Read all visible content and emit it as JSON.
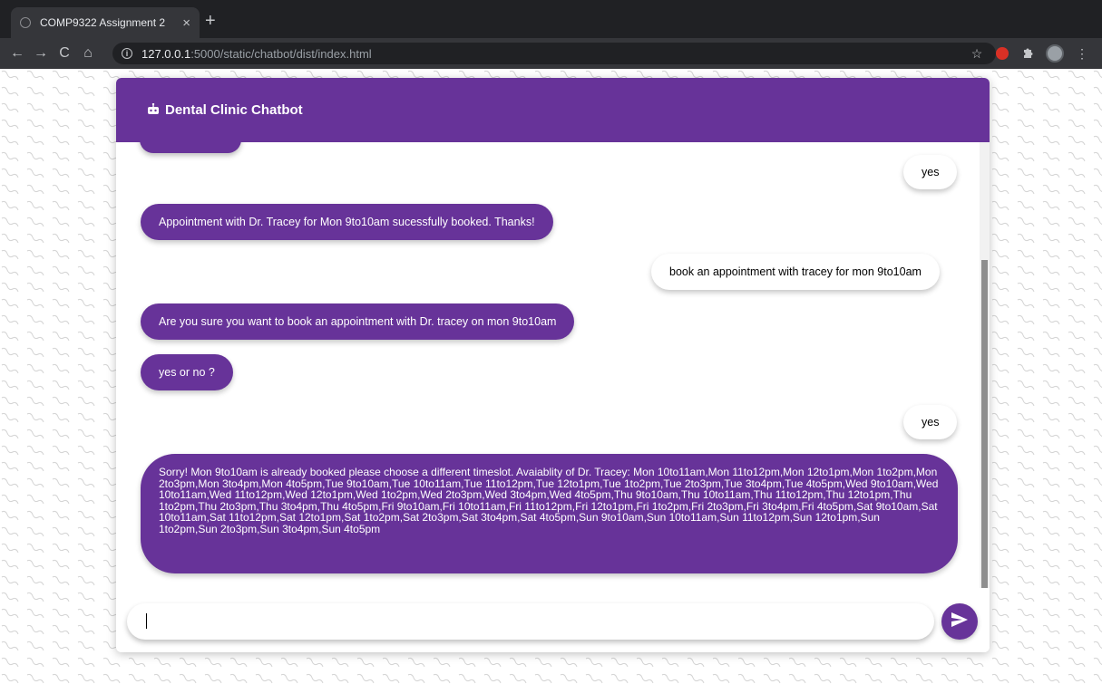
{
  "browser": {
    "tab_title": "COMP9322 Assignment 2",
    "tab_close": "×",
    "new_tab": "+",
    "url_host": "127.0.0.1",
    "url_path": ":5000/static/chatbot/dist/index.html",
    "back_icon": "←",
    "forward_icon": "→",
    "reload_icon": "C",
    "home_icon": "⌂",
    "info_icon": "i",
    "star_icon": "☆",
    "menu_icon": "⋮"
  },
  "chat": {
    "title": "Dental Clinic Chatbot",
    "header_icon": "robot-icon",
    "accent_color": "#673399",
    "input_value": "",
    "messages": [
      {
        "sender": "user",
        "text": "yes"
      },
      {
        "sender": "bot",
        "text": "Appointment with Dr. Tracey for Mon 9to10am sucessfully booked. Thanks!"
      },
      {
        "sender": "user",
        "text": "book an appointment with tracey for mon 9to10am"
      },
      {
        "sender": "bot",
        "text": "Are you sure you want to book an appointment with Dr. tracey on mon 9to10am"
      },
      {
        "sender": "bot",
        "text": "yes or no ?"
      },
      {
        "sender": "user",
        "text": "yes"
      },
      {
        "sender": "bot",
        "text": "Sorry! Mon 9to10am is already booked please choose a different timeslot. Avaiablity of Dr. Tracey: Mon 10to11am,Mon 11to12pm,Mon 12to1pm,Mon 1to2pm,Mon 2to3pm,Mon 3to4pm,Mon 4to5pm,Tue 9to10am,Tue 10to11am,Tue 11to12pm,Tue 12to1pm,Tue 1to2pm,Tue 2to3pm,Tue 3to4pm,Tue 4to5pm,Wed 9to10am,Wed 10to11am,Wed 11to12pm,Wed 12to1pm,Wed 1to2pm,Wed 2to3pm,Wed 3to4pm,Wed 4to5pm,Thu 9to10am,Thu 10to11am,Thu 11to12pm,Thu 12to1pm,Thu 1to2pm,Thu 2to3pm,Thu 3to4pm,Thu 4to5pm,Fri 9to10am,Fri 10to11am,Fri 11to12pm,Fri 12to1pm,Fri 1to2pm,Fri 2to3pm,Fri 3to4pm,Fri 4to5pm,Sat 9to10am,Sat 10to11am,Sat 11to12pm,Sat 12to1pm,Sat 1to2pm,Sat 2to3pm,Sat 3to4pm,Sat 4to5pm,Sun 9to10am,Sun 10to11am,Sun 11to12pm,Sun 12to1pm,Sun 1to2pm,Sun 2to3pm,Sun 3to4pm,Sun 4to5pm"
      }
    ]
  }
}
